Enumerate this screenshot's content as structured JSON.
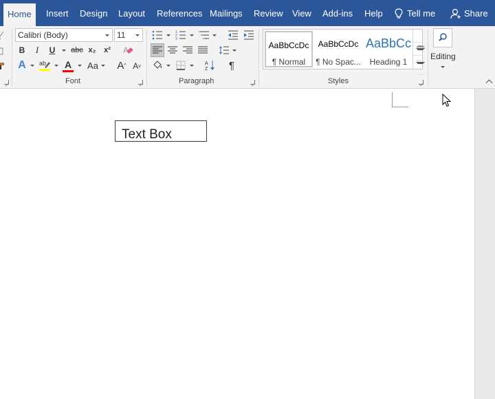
{
  "tabs": [
    {
      "label": "Home",
      "active": true
    },
    {
      "label": "Insert"
    },
    {
      "label": "Design"
    },
    {
      "label": "Layout"
    },
    {
      "label": "References"
    },
    {
      "label": "Mailings"
    },
    {
      "label": "Review"
    },
    {
      "label": "View"
    },
    {
      "label": "Add-ins"
    },
    {
      "label": "Help"
    }
  ],
  "tell_me": "Tell me",
  "share": "Share",
  "font": {
    "name": "Calibri (Body)",
    "size": "11",
    "bold": "B",
    "italic": "I",
    "underline": "U",
    "strike": "abc",
    "subscript": "x₂",
    "superscript": "x²",
    "text_effects": "A",
    "font_color": "A",
    "change_case": "Aa",
    "grow": "A",
    "shrink": "A",
    "highlight_color": "#ffff00",
    "font_color_value": "#ff0000"
  },
  "paragraph": {
    "pilcrow": "¶"
  },
  "styles": [
    {
      "preview": "AaBbCcDc",
      "name": "¶ Normal",
      "selected": true
    },
    {
      "preview": "AaBbCcDc",
      "name": "¶ No Spac..."
    },
    {
      "preview": "AaBbCc",
      "name": "Heading 1"
    }
  ],
  "groups": {
    "font": "Font",
    "paragraph": "Paragraph",
    "styles": "Styles"
  },
  "editing": "Editing",
  "document": {
    "textbox_text": "Text Box"
  },
  "colors": {
    "ribbon_blue": "#2b579a",
    "ribbon_bg": "#f3f3f3",
    "heading_blue": "#2e74b5"
  }
}
